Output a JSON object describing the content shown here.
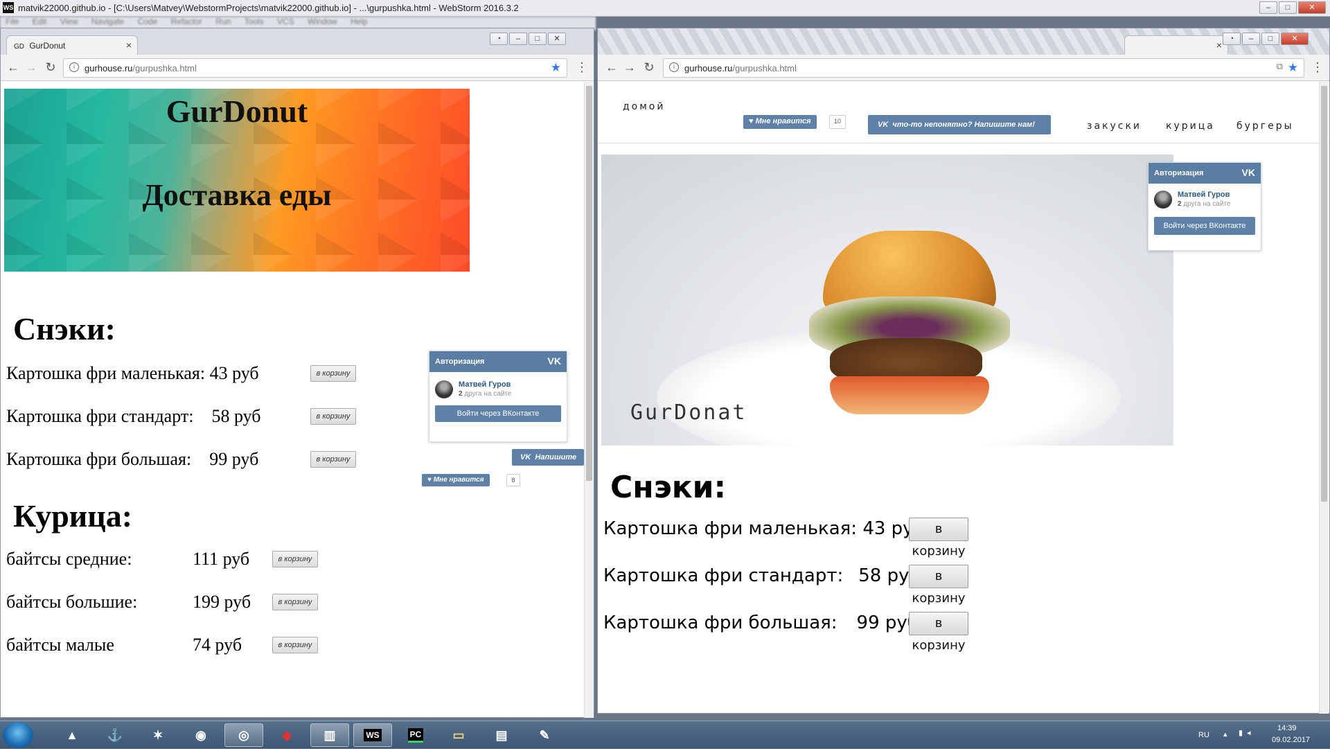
{
  "webstorm": {
    "title": "matvik22000.github.io - [C:\\Users\\Matvey\\WebstormProjects\\matvik22000.github.io] - ...\\gurpushka.html - WebStorm 2016.3.2",
    "menu": [
      "File",
      "Edit",
      "View",
      "Navigate",
      "Code",
      "Refactor",
      "Run",
      "Tools",
      "VCS",
      "Window",
      "Help"
    ]
  },
  "left_browser": {
    "tab_title": "GurDonut",
    "tab_favicon": "GD",
    "url_host": "gurhouse.ru",
    "url_path": "/gurpushka.html",
    "banner_title": "GurDonut",
    "banner_subtitle": "Доставка еды",
    "sections": [
      {
        "heading": "Снэки:",
        "items": [
          {
            "name": "Картошка фри маленькая:",
            "price": "43 руб",
            "button": "в корзину"
          },
          {
            "name": "Картошка фри стандарт:",
            "price": "58 руб",
            "button": "в корзину"
          },
          {
            "name": "Картошка фри большая:",
            "price": "99 руб",
            "button": "в корзину"
          }
        ]
      },
      {
        "heading": "Курица:",
        "items": [
          {
            "name": "байтсы средние:",
            "price": "111 руб",
            "button": "в корзину"
          },
          {
            "name": "байтсы большие:",
            "price": "199 руб",
            "button": "в корзину"
          },
          {
            "name": "байтсы малые",
            "price": "74 руб",
            "button": "в корзину"
          }
        ]
      }
    ],
    "vk_auth": {
      "header": "Авторизация",
      "logo": "VK",
      "name": "Матвей Гуров",
      "friends_count": "2",
      "friends_text": "друга на сайте",
      "button": "Войти через ВКонтакте"
    },
    "vk_message": "Напишите",
    "vk_like": {
      "label": "Мне нравится",
      "count": "8"
    }
  },
  "right_browser": {
    "url_host": "gurhouse.ru",
    "url_path": "/gurpushka.html",
    "nav_home": "домой",
    "nav_links": [
      "закуски",
      "курица",
      "бургеры"
    ],
    "vk_like": {
      "label": "Мне нравится",
      "count": "10"
    },
    "vk_message": "что-то непонятно? Напишите нам!",
    "vk_auth": {
      "header": "Авторизация",
      "logo": "VK",
      "name": "Матвей Гуров",
      "friends_count": "2",
      "friends_text": "друга на сайте",
      "button": "Войти через ВКонтакте"
    },
    "hero_brand": "GurDonat",
    "section_heading": "Снэки:",
    "items": [
      {
        "name": "Картошка фри маленькая:",
        "price": "43 руб",
        "button": "в корзину"
      },
      {
        "name": "Картошка фри стандарт:",
        "price": "58 руб",
        "button": "в корзину"
      },
      {
        "name": "Картошка фри большая:",
        "price": "99 руб",
        "button": "в корзину"
      }
    ]
  },
  "taskbar": {
    "language": "RU",
    "time": "14:39",
    "date": "09.02.2017",
    "apps": [
      "assassin-icon",
      "world-of-warships-icon",
      "battlenet-icon",
      "steam-icon",
      "chrome-icon",
      "dota2-icon",
      "taskmanager-icon",
      "webstorm-icon",
      "pycharm-icon",
      "explorer-icon",
      "file-manager-icon",
      "paint-icon"
    ],
    "webstorm_label": "WS",
    "pycharm_label": "PC"
  },
  "colors": {
    "vk_blue": "#5e81a8",
    "vk_header": "#597da3",
    "link_blue": "#2a5885",
    "star_blue": "#3a79e9"
  }
}
